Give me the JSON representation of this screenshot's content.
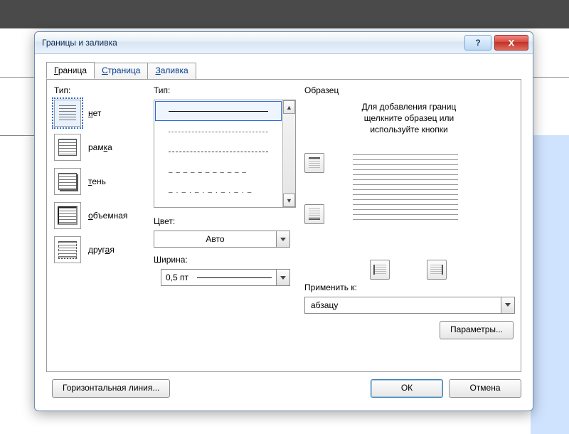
{
  "window": {
    "title": "Границы и заливка",
    "help": "?",
    "close": "X"
  },
  "tabs": {
    "t1a": "Г",
    "t1b": "раница",
    "t2a": "С",
    "t2b": "траница",
    "t3a": "З",
    "t3b": "аливка"
  },
  "left": {
    "heading": "Тип:",
    "p1a": "н",
    "p1b": "ет",
    "p2a": "рам",
    "p2b": "к",
    "p2c": "а",
    "p3a": "т",
    "p3b": "ень",
    "p4a": "о",
    "p4b": "бъемная",
    "p5a": "друг",
    "p5b": "а",
    "p5c": "я"
  },
  "mid": {
    "styleHeading": "Тип:",
    "colorHeading": "Цвет:",
    "colorValue": "Авто",
    "widthHeading": "Ширина:",
    "widthValue": "0,5 пт"
  },
  "right": {
    "heading": "Образец",
    "hint1": "Для добавления границ",
    "hint2": "щелкните образец или",
    "hint3": "используйте кнопки",
    "applyHeading": "Применить к:",
    "applyValue": "абзацу",
    "optionsBtn": "Параметры..."
  },
  "bottom": {
    "hline": "Горизонтальная линия...",
    "ok": "ОК",
    "cancel": "Отмена"
  }
}
